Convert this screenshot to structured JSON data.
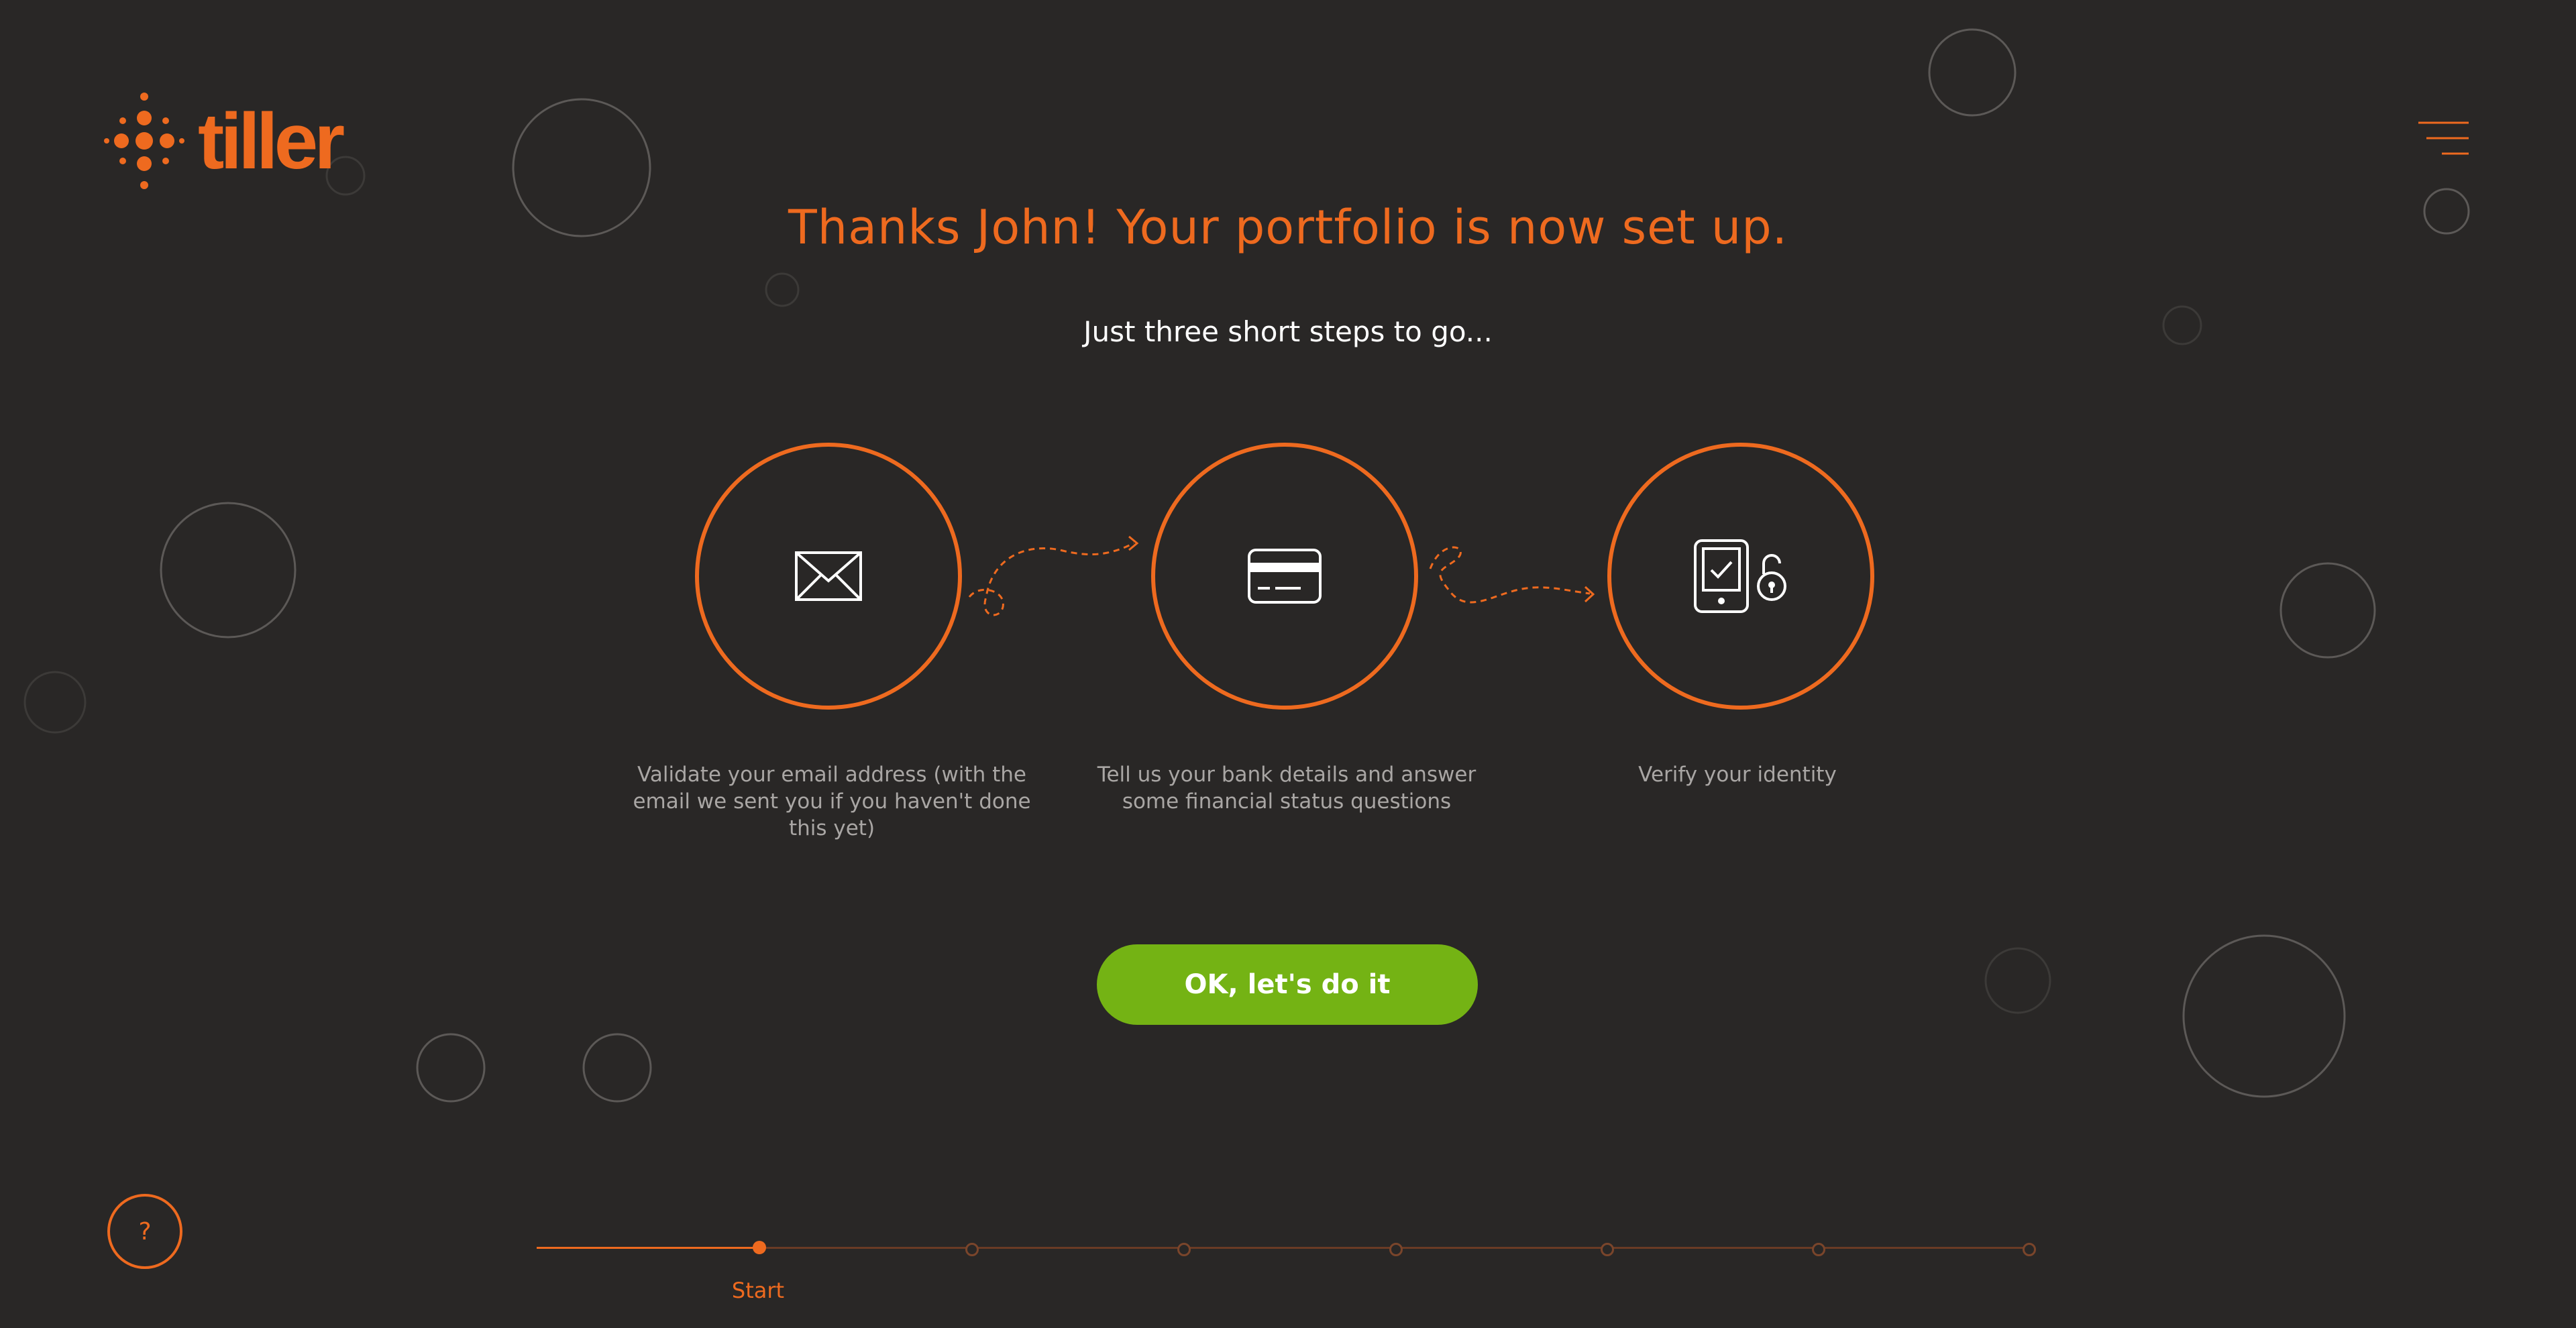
{
  "brand": {
    "name": "tiller",
    "accent": "#ee6a1f",
    "cta_color": "#74b314",
    "background": "#292726"
  },
  "header": {
    "menu_icon": "hamburger-menu-icon"
  },
  "main": {
    "headline": "Thanks John! Your portfolio is now set up.",
    "subline": "Just three short steps to go...",
    "steps": [
      {
        "icon": "envelope-icon",
        "label": "Validate your email address (with the email we sent you if you haven't done this yet)"
      },
      {
        "icon": "credit-card-icon",
        "label": "Tell us your bank details and answer some financial status questions"
      },
      {
        "icon": "phone-unlock-icon",
        "label": "Verify your identity"
      }
    ],
    "cta_label": "OK, let's do it"
  },
  "help": {
    "label": "?"
  },
  "progress": {
    "current_label": "Start",
    "total_nodes": 7,
    "current_index": 0
  }
}
